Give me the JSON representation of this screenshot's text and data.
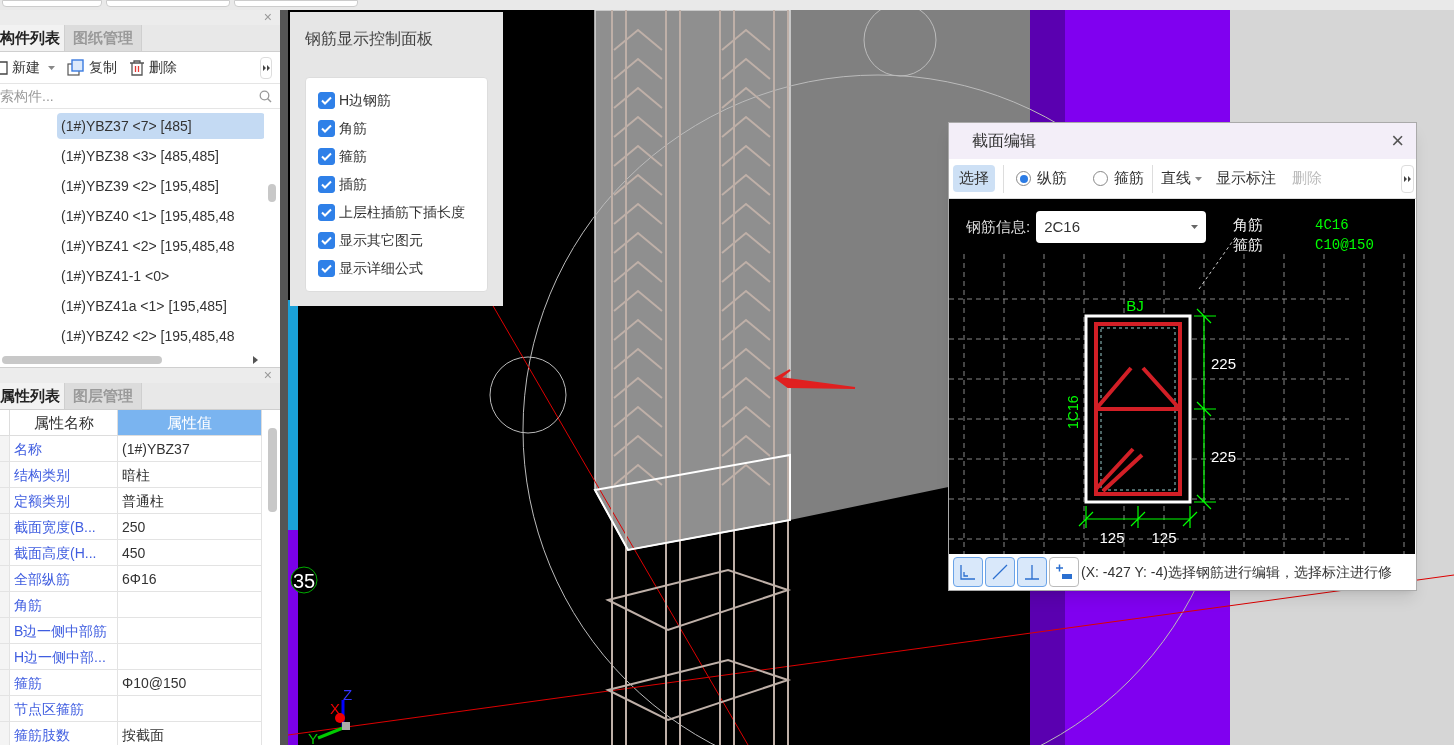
{
  "component_panel": {
    "close": "×",
    "tabs": [
      {
        "label": "构件列表",
        "selected": true
      },
      {
        "label": "图纸管理",
        "selected": false
      }
    ],
    "toolbar": [
      {
        "label": "新建",
        "kind": "new"
      },
      {
        "label": "复制",
        "kind": "copy"
      },
      {
        "label": "删除",
        "kind": "delete"
      }
    ],
    "search": {
      "placeholder": "索构件..."
    },
    "items": [
      {
        "label": "(1#)YBZ37 <7> [485]",
        "selected": true
      },
      {
        "label": "(1#)YBZ38 <3> [485,485]",
        "selected": false
      },
      {
        "label": "(1#)YBZ39 <2> [195,485]",
        "selected": false
      },
      {
        "label": "(1#)YBZ40 <1> [195,485,48",
        "selected": false
      },
      {
        "label": "(1#)YBZ41 <2> [195,485,48",
        "selected": false
      },
      {
        "label": "(1#)YBZ41-1 <0>",
        "selected": false
      },
      {
        "label": "(1#)YBZ41a <1> [195,485]",
        "selected": false
      },
      {
        "label": "(1#)YBZ42 <2> [195,485,48",
        "selected": false
      }
    ]
  },
  "property_panel": {
    "close": "×",
    "tabs": [
      {
        "label": "属性列表",
        "selected": true
      },
      {
        "label": "图层管理",
        "selected": false
      }
    ],
    "columns": [
      {
        "label": "属性名称",
        "selected": false
      },
      {
        "label": "属性值",
        "selected": true
      }
    ],
    "rows": [
      {
        "name": "名称",
        "value": "(1#)YBZ37"
      },
      {
        "name": "结构类别",
        "value": "暗柱"
      },
      {
        "name": "定额类别",
        "value": "普通柱"
      },
      {
        "name": "截面宽度(B...",
        "value": "250"
      },
      {
        "name": "截面高度(H...",
        "value": "450"
      },
      {
        "name": "全部纵筋",
        "value": "6Φ16"
      },
      {
        "name": "角筋",
        "value": ""
      },
      {
        "name": "B边一侧中部筋",
        "value": ""
      },
      {
        "name": "H边一侧中部...",
        "value": ""
      },
      {
        "name": "箍筋",
        "value": "Φ10@150"
      },
      {
        "name": "节点区箍筋",
        "value": ""
      },
      {
        "name": "箍筋肢数",
        "value": "按截面"
      }
    ]
  },
  "rebar_display_panel": {
    "title": "钢筋显示控制面板",
    "options": [
      {
        "label": "H边钢筋",
        "checked": true
      },
      {
        "label": "角筋",
        "checked": true
      },
      {
        "label": "箍筋",
        "checked": true
      },
      {
        "label": "插筋",
        "checked": true
      },
      {
        "label": "上层柱插筋下插长度",
        "checked": true
      },
      {
        "label": "显示其它图元",
        "checked": true
      },
      {
        "label": "显示详细公式",
        "checked": true
      }
    ]
  },
  "section_editor": {
    "title": "截面编辑",
    "close": "×",
    "select_button": {
      "label": "选择",
      "selected": true
    },
    "rebar_type": [
      {
        "label": "纵筋",
        "selected": true
      },
      {
        "label": "箍筋",
        "selected": false
      }
    ],
    "line_type": "直线",
    "show_labels": {
      "label": "显示标注",
      "disabled": false
    },
    "delete": {
      "label": "删除",
      "disabled": true
    },
    "rebar_info": {
      "label": "钢筋信息:",
      "value": "2C16"
    },
    "legend": [
      {
        "name": "角筋",
        "value": "4C16"
      },
      {
        "name": "箍筋",
        "value": "C10@150"
      }
    ],
    "drawing_labels": {
      "top": "BJ",
      "side": "1C16",
      "heights": [
        "225",
        "225"
      ],
      "widths": [
        "125",
        "125"
      ]
    },
    "status": "(X: -427 Y: -4)选择钢筋进行编辑，选择标注进行修"
  },
  "viewport": {
    "marker": "35",
    "axes": [
      "X",
      "Y",
      "Z"
    ]
  }
}
